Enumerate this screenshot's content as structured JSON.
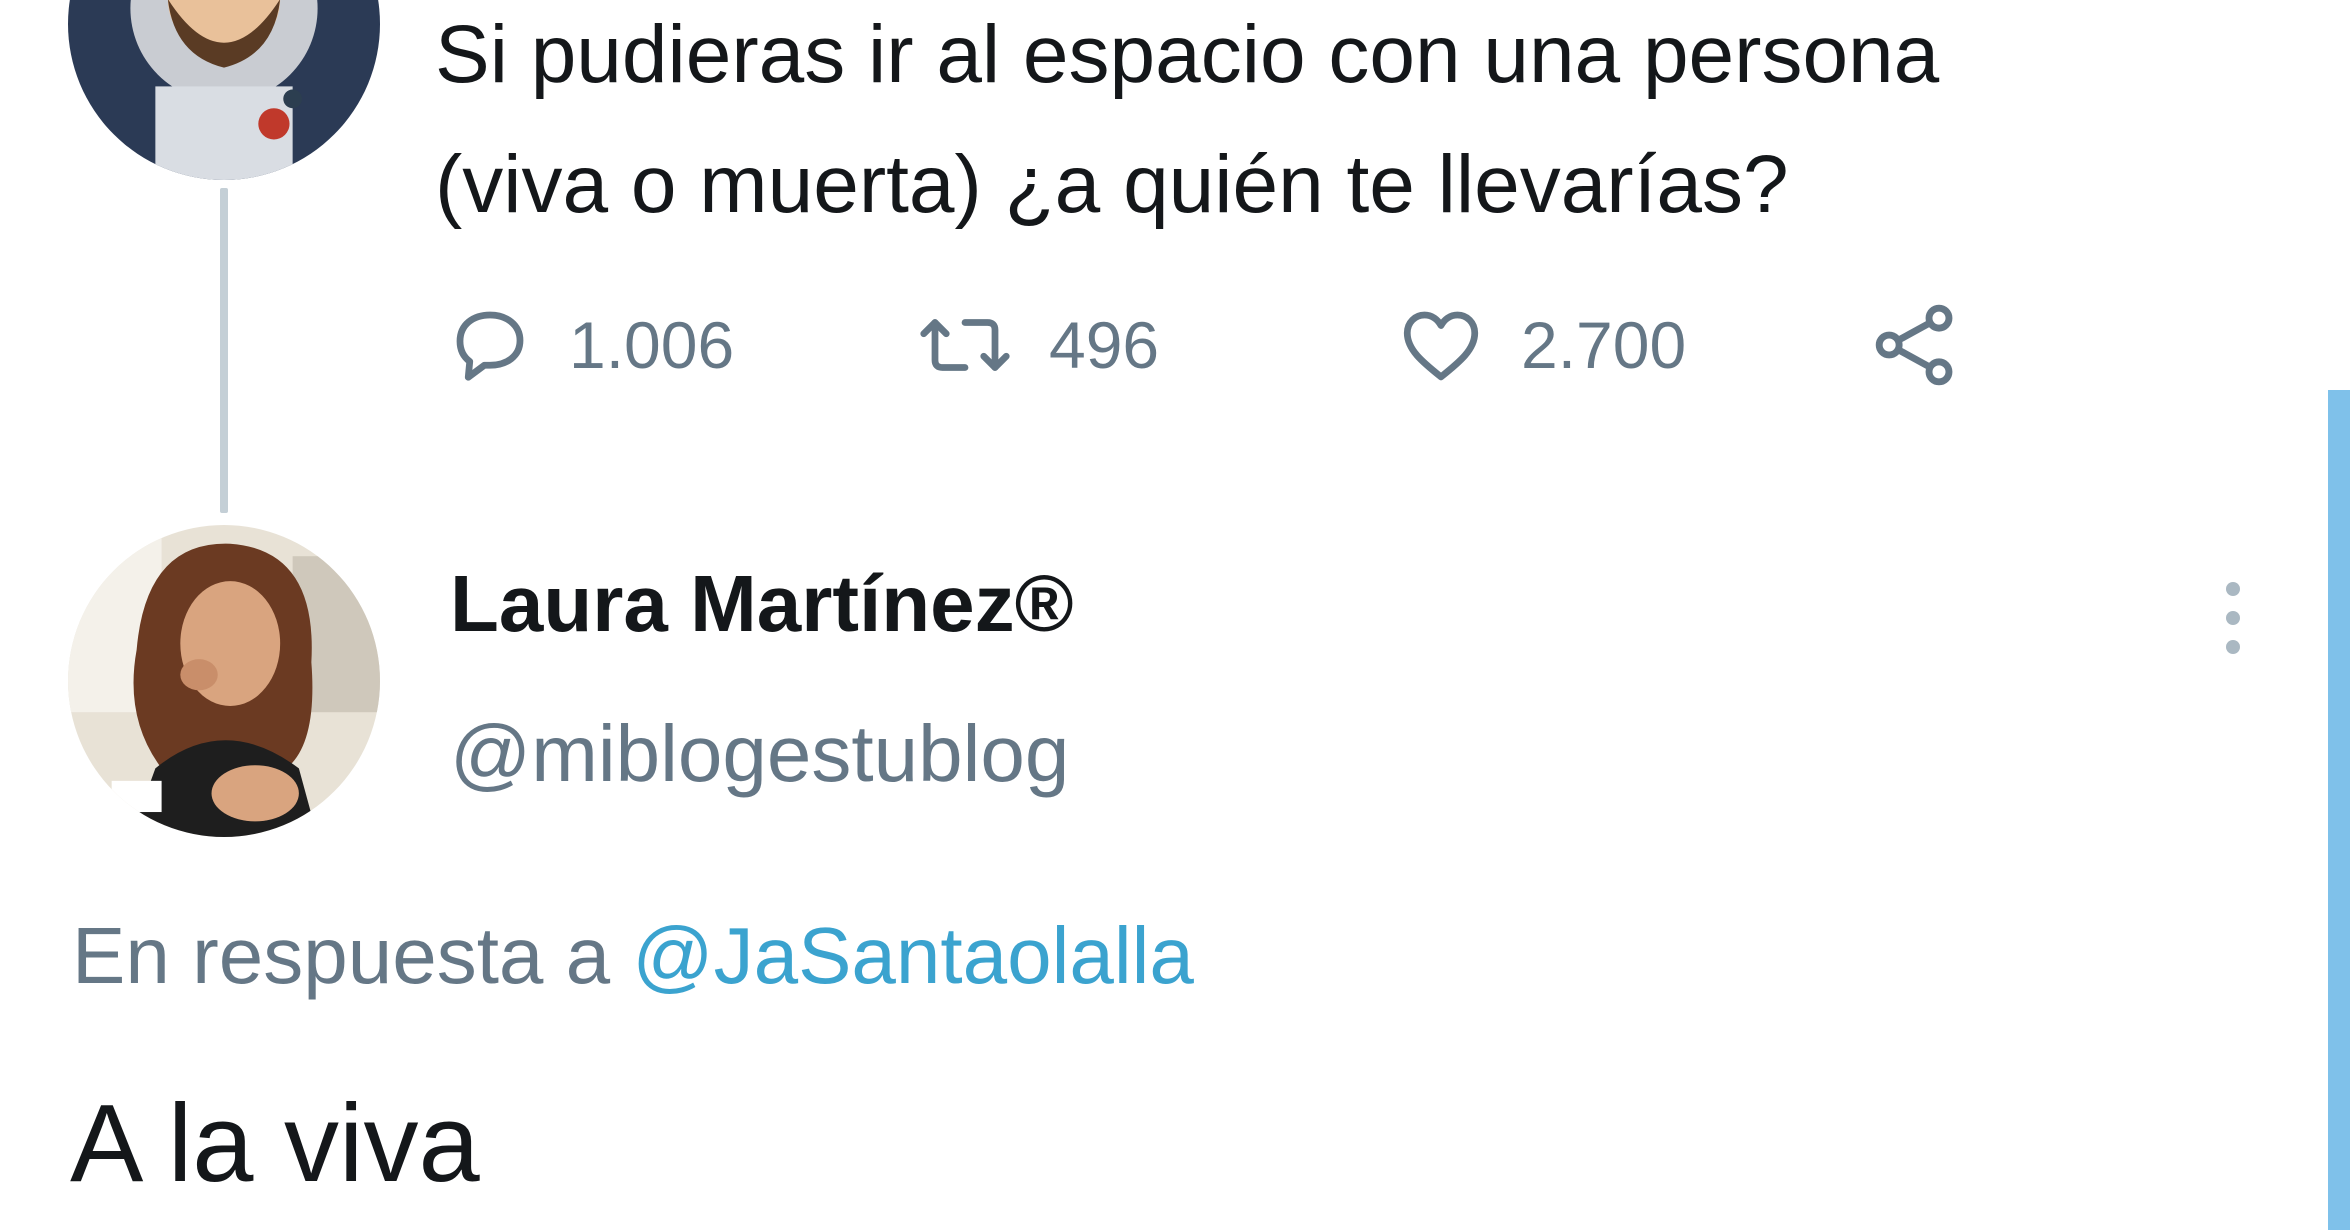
{
  "tweet": {
    "line1": "Si pudieras ir al espacio con una persona",
    "line2": "(viva o muerta) ¿a quién te llevarías?",
    "replies": "1.006",
    "retweets": "496",
    "likes": "2.700",
    "icons": [
      "reply-icon",
      "retweet-icon",
      "heart-icon",
      "share-icon"
    ]
  },
  "reply": {
    "author_name": "Laura Martínez®",
    "author_handle": "@miblogestublog",
    "context_prefix": "En respuesta a",
    "context_mention": "@JaSantaolalla",
    "text": "A la viva"
  },
  "colors": {
    "text": "#14171a",
    "muted": "#657786",
    "accent": "#3ba3cf",
    "thread_line": "#c4cfd6"
  }
}
